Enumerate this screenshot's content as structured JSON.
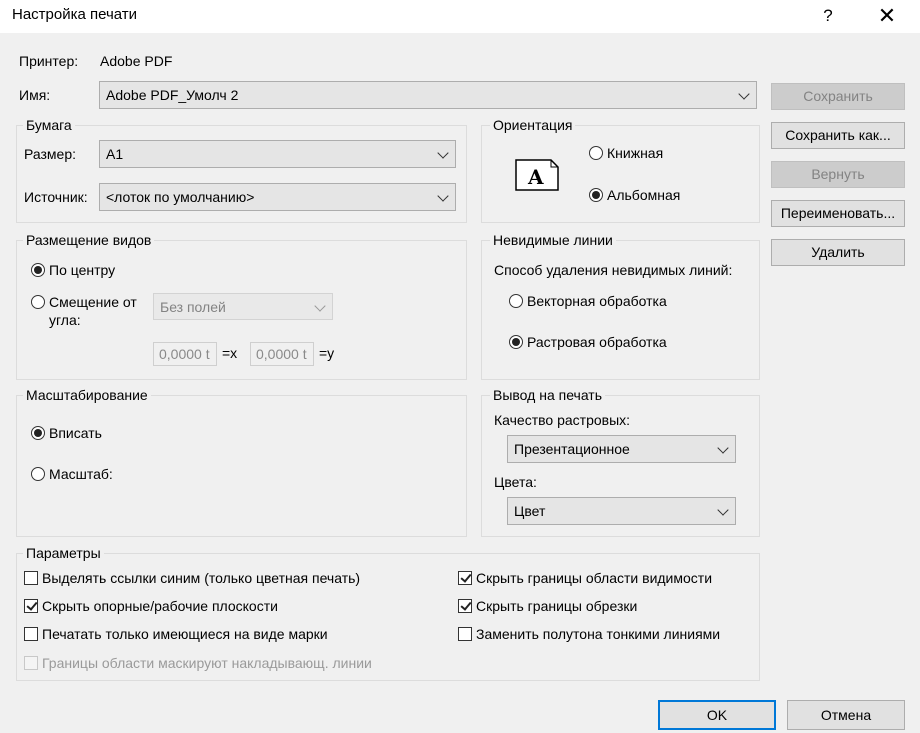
{
  "dialog": {
    "title": "Настройка печати",
    "help_glyph": "?",
    "close_glyph": "✕"
  },
  "printer": {
    "label": "Принтер:",
    "value": "Adobe PDF"
  },
  "name": {
    "label": "Имя:",
    "value": "Adobe PDF_Умолч 2"
  },
  "buttons": {
    "save": "Сохранить",
    "save_as": "Сохранить как...",
    "revert": "Вернуть",
    "rename": "Переименовать...",
    "delete": "Удалить",
    "ok": "OK",
    "cancel": "Отмена"
  },
  "paper": {
    "title": "Бумага",
    "size_label": "Размер:",
    "size_value": "A1",
    "source_label": "Источник:",
    "source_value": "<лоток по умолчанию>"
  },
  "orientation": {
    "title": "Ориентация",
    "icon_letter": "A",
    "portrait": "Книжная",
    "landscape": "Альбомная",
    "selected": "landscape"
  },
  "placement": {
    "title": "Размещение видов",
    "center": "По центру",
    "offset_line1": "Смещение от",
    "offset_line2": "угла:",
    "margin_value": "Без полей",
    "x_value": "0,0000 t",
    "x_suffix": "=x",
    "y_value": "0,0000 t",
    "y_suffix": "=y",
    "selected": "center"
  },
  "hidden_lines": {
    "title": "Невидимые линии",
    "method_label": "Способ удаления невидимых линий:",
    "vector": "Векторная обработка",
    "raster": "Растровая обработка",
    "selected": "raster"
  },
  "zoom": {
    "title": "Масштабирование",
    "fit": "Вписать",
    "scale": "Масштаб:",
    "selected": "fit"
  },
  "output": {
    "title": "Вывод на печать",
    "quality_label": "Качество растровых:",
    "quality_value": "Презентационное",
    "colors_label": "Цвета:",
    "colors_value": "Цвет"
  },
  "options": {
    "title": "Параметры",
    "items": [
      {
        "label": "Выделять ссылки синим (только цветная печать)",
        "checked": false,
        "enabled": true
      },
      {
        "label": "Скрыть опорные/рабочие плоскости",
        "checked": true,
        "enabled": true
      },
      {
        "label": "Печатать только имеющиеся на виде марки",
        "checked": false,
        "enabled": true
      },
      {
        "label": "Границы области маскируют накладывающ. линии",
        "checked": false,
        "enabled": false
      },
      {
        "label": "Скрыть границы области видимости",
        "checked": true,
        "enabled": true
      },
      {
        "label": "Скрыть границы обрезки",
        "checked": true,
        "enabled": true
      },
      {
        "label": "Заменить полутона тонкими линиями",
        "checked": false,
        "enabled": true
      }
    ]
  }
}
